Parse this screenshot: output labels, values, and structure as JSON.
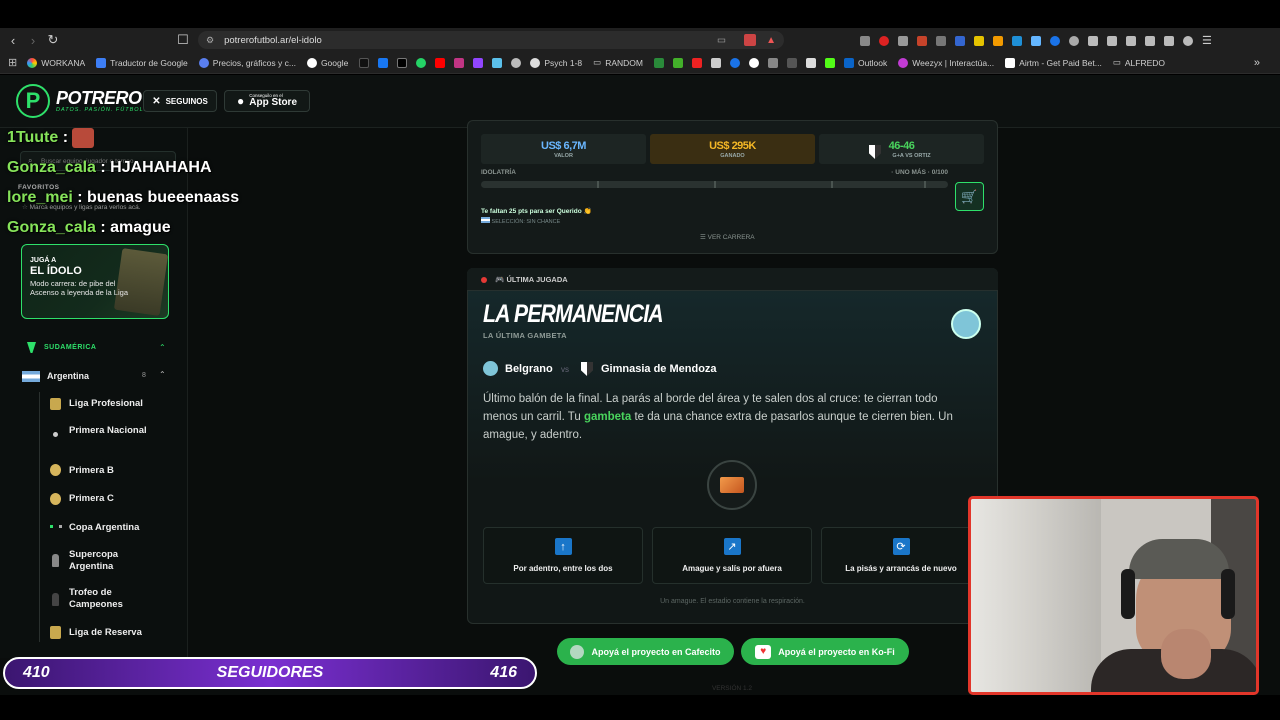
{
  "browser": {
    "url": "potrerofutbol.ar/el-idolo",
    "bookmarks": [
      "WORKANA",
      "Traductor de Google",
      "Precios, gráficos y c...",
      "Google",
      "Psych 1-8",
      "RANDOM",
      "Outlook",
      "Weezyx | Interactúa...",
      "Airtm - Get Paid Bet...",
      "ALFREDO"
    ]
  },
  "header": {
    "brand": "POTRERO",
    "tagline": "DATOS. PASIÓN. FÚTBOL.",
    "follow_label": "SEGUINOS",
    "appstore_small": "Conseguilo en el",
    "appstore_big": "App Store"
  },
  "chat": [
    {
      "user": "1Tuute",
      "msg": ""
    },
    {
      "user": "Gonza_cala",
      "msg": "HJAHAHAHA"
    },
    {
      "user": "lore_mei",
      "msg": "buenas bueeenaass"
    },
    {
      "user": "Gonza_cala",
      "msg": "amague"
    }
  ],
  "sidebar": {
    "search_placeholder": "Buscar equipo, jugador o torneo",
    "favorites_title": "FAVORITOS",
    "favorites_hint": "Marcá equipos y ligas para verlos acá.",
    "promo": {
      "line1": "JUGÁ A",
      "line2": "EL ÍDOLO",
      "text": "Modo carrera: de pibe del Ascenso a leyenda de la Liga"
    },
    "region": "SUDAMÉRICA",
    "country": "Argentina",
    "country_count": "8",
    "leagues": [
      "Liga Profesional",
      "Primera Nacional",
      "Primera B",
      "Primera C",
      "Copa Argentina",
      "Supercopa Argentina",
      "Trofeo de Campeones",
      "Liga de Reserva"
    ]
  },
  "career": {
    "stats": [
      {
        "value": "US$ 6,7M",
        "label": "VALOR"
      },
      {
        "value": "US$ 295K",
        "label": "GANADO"
      },
      {
        "value": "46-46",
        "label": "G+A VS ORTIZ"
      }
    ],
    "idolatria_label": "IDOLATRÍA",
    "idolatria_right": "· UNO MÁS · 0/100",
    "hint": "Te faltan 25 pts para ser Querido 👏",
    "selection": "SELECCIÓN: SIN CHANCE",
    "ver_carrera": "VER CARRERA"
  },
  "play": {
    "tag": "ÚLTIMA JUGADA",
    "title": "LA PERMANENCIA",
    "subtitle": "LA ÚLTIMA GAMBETA",
    "home": "Belgrano",
    "vs": "vs",
    "away": "Gimnasia de Mendoza",
    "text_before": "Último balón de la final. La parás al borde del área y te salen dos al cruce: te cierran todo menos un carril. Tu ",
    "highlight": "gambeta",
    "text_after": " te da una chance extra de pasarlos aunque te cierren bien. Un amague, y adentro.",
    "options": [
      {
        "icon": "arrow-up-icon",
        "label": "Por adentro, entre los dos"
      },
      {
        "icon": "arrow-diagonal-icon",
        "label": "Amague y salís por afuera"
      },
      {
        "icon": "refresh-icon",
        "label": "La pisás y arrancás de nuevo"
      }
    ],
    "footer": "Un amague. El estadio contiene la respiración."
  },
  "support": {
    "cafecito": "Apoyá el proyecto en Cafecito",
    "kofi": "Apoyá el proyecto en Ko-Fi"
  },
  "version": "VERSIÓN 1.2",
  "overlay": {
    "left_count": "410",
    "label": "SEGUIDORES",
    "right_count": "416"
  },
  "colors": {
    "accent_green": "#2ee06a",
    "highlight_green": "#49d45d",
    "webcam_border": "#e2362a",
    "followers_bar": "#7a2fd1"
  }
}
